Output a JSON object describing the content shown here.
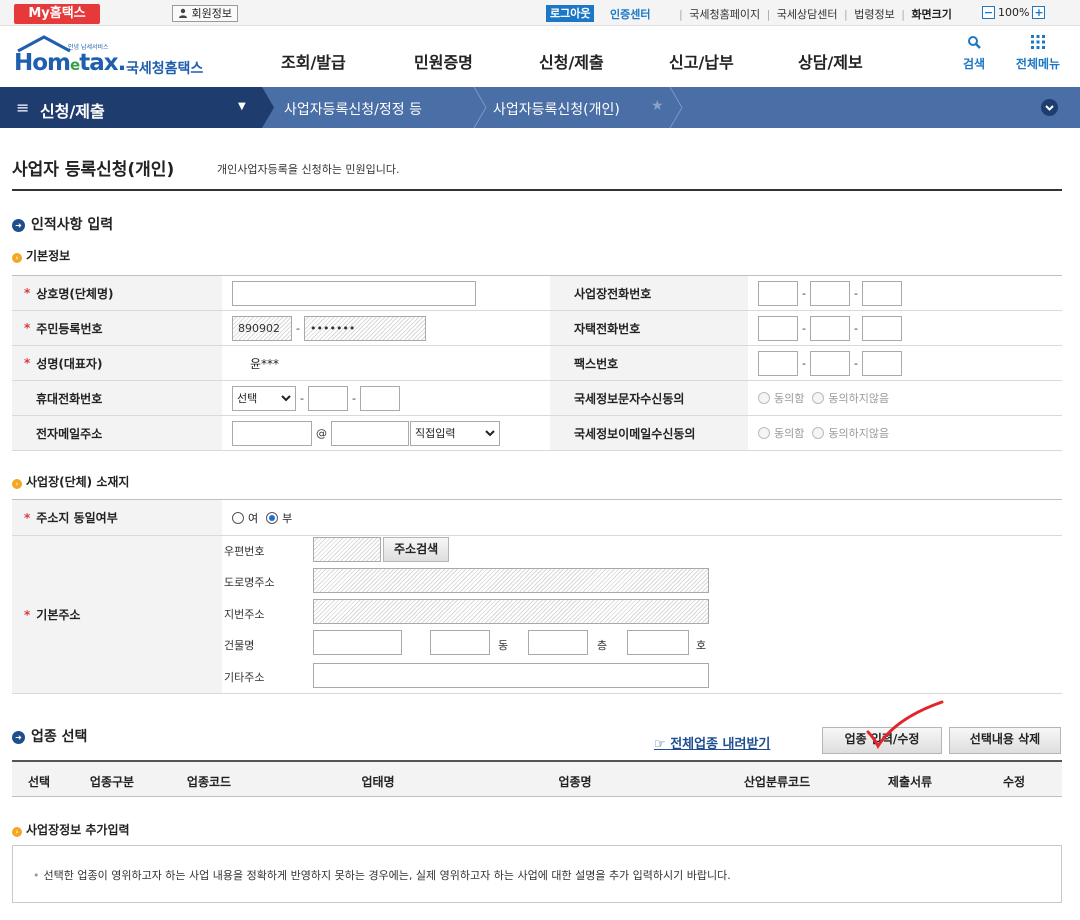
{
  "topbar": {
    "myhome": "My홈택스",
    "member_info": "회원정보",
    "logout": "로그아웃",
    "cert_center": "인증센터",
    "links": [
      "국세청홈페이지",
      "국세상담센터",
      "법령정보"
    ],
    "screen_size_label": "화면크기",
    "zoom_minus": "−",
    "zoom_value": "100%",
    "zoom_plus": "+"
  },
  "header": {
    "logo_sub": "안녕 납세서비스",
    "logo_home": "Hom",
    "logo_e": "e",
    "logo_tax": "tax.",
    "logo_kname": "국세청홈택스",
    "gnb": [
      "조회/발급",
      "민원증명",
      "신청/제출",
      "신고/납부",
      "상담/제보"
    ],
    "search_label": "검색",
    "menu_label": "전체메뉴"
  },
  "breadcrumb": {
    "menu_icon": "≡",
    "level1": "신청/제출",
    "level1_caret": "▼",
    "level2": "사업자등록신청/정정 등",
    "level3": "사업자등록신청(개인)",
    "star": "★",
    "toggle_icon": "❯"
  },
  "page": {
    "title": "사업자 등록신청(개인)",
    "description": "개인사업자등록을 신청하는 민원입니다."
  },
  "personal": {
    "section_title": "인적사항 입력",
    "sub_title": "기본정보",
    "required_mark": "*",
    "labels": {
      "company_name": "상호명(단체명)",
      "resident_no": "주민등록번호",
      "name": "성명(대표자)",
      "mobile": "휴대전화번호",
      "email": "전자메일주소",
      "biz_phone": "사업장전화번호",
      "home_phone": "자택전화번호",
      "fax": "팩스번호",
      "sms_consent": "국세정보문자수신동의",
      "email_consent": "국세정보이메일수신동의"
    },
    "values": {
      "company_name": "",
      "resident_front": "890902",
      "resident_back": "•••••••",
      "name": "윤***",
      "mobile_carrier": "선택",
      "email_at": "@",
      "email_domain_select": "직접입력"
    },
    "dash": "-",
    "consent_options": [
      "동의함",
      "동의하지않음"
    ],
    "select_caret": "❯"
  },
  "address": {
    "sub_title": "사업장(단체) 소재지",
    "same_label": "주소지 동일여부",
    "same_options": [
      "여",
      "부"
    ],
    "same_selected": "부",
    "base_label": "기본주소",
    "postcode_label": "우편번호",
    "search_btn": "주소검색",
    "road_label": "도로명주소",
    "lot_label": "지번주소",
    "building_label": "건물명",
    "dong": "동",
    "floor": "층",
    "ho": "호",
    "other_label": "기타주소"
  },
  "industry": {
    "section_title": "업종 선택",
    "download_link": "전체업종 내려받기",
    "download_icon": "☞",
    "edit_btn": "업종 입력/수정",
    "delete_btn": "선택내용 삭제",
    "columns": [
      "선택",
      "업종구분",
      "업종코드",
      "업태명",
      "업종명",
      "산업분류코드",
      "제출서류",
      "수정"
    ]
  },
  "extra": {
    "sub_title": "사업장정보 추가입력",
    "bullet": "•",
    "notice": "선택한 업종이 영위하고자 하는 사업 내용을 정확하게 반영하지 못하는 경우에는, 실제 영위하고자 하는 사업에 대한 설명을 추가 입력하시기 바랍니다."
  },
  "colors": {
    "brand_red": "#e6393a",
    "brand_blue": "#1c78c7",
    "nav_dark": "#1f3c6e",
    "nav_light": "#4a6ea6"
  }
}
